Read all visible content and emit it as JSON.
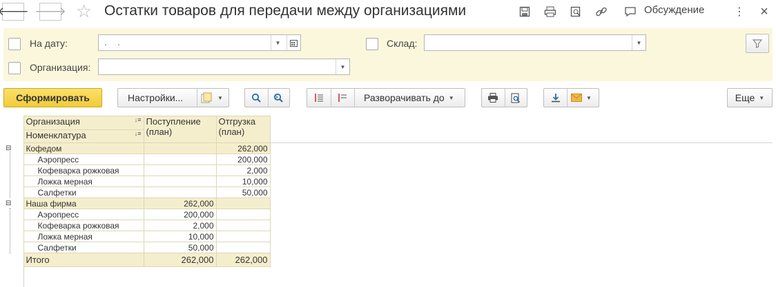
{
  "header": {
    "title": "Остатки товаров для передачи между организациями",
    "discuss_label": "Обсуждение",
    "close_label": "×"
  },
  "filters": {
    "date_label": "На дату:",
    "date_value": ". .",
    "warehouse_label": "Склад:",
    "warehouse_value": "",
    "org_label": "Организация:",
    "org_value": ""
  },
  "toolbar": {
    "generate_label": "Сформировать",
    "settings_label": "Настройки...",
    "expand_label": "Разворачивать до",
    "more_label": "Еще"
  },
  "report": {
    "columns": {
      "org": "Организация",
      "item": "Номенклатура",
      "receipt": "Поступление (план)",
      "receipt_l1": "Поступление",
      "receipt_l2": "(план)",
      "shipment_l1": "Отгрузка",
      "shipment_l2": "(план)"
    },
    "groups": [
      {
        "name": "Кофедом",
        "receipt": "",
        "shipment": "262,000",
        "rows": [
          {
            "name": "Аэропресс",
            "receipt": "",
            "shipment": "200,000"
          },
          {
            "name": "Кофеварка рожковая",
            "receipt": "",
            "shipment": "2,000"
          },
          {
            "name": "Ложка мерная",
            "receipt": "",
            "shipment": "10,000"
          },
          {
            "name": "Салфетки",
            "receipt": "",
            "shipment": "50,000"
          }
        ]
      },
      {
        "name": "Наша фирма",
        "receipt": "262,000",
        "shipment": "",
        "rows": [
          {
            "name": "Аэропресс",
            "receipt": "200,000",
            "shipment": ""
          },
          {
            "name": "Кофеварка рожковая",
            "receipt": "2,000",
            "shipment": ""
          },
          {
            "name": "Ложка мерная",
            "receipt": "10,000",
            "shipment": ""
          },
          {
            "name": "Салфетки",
            "receipt": "50,000",
            "shipment": ""
          }
        ]
      }
    ],
    "total": {
      "label": "Итого",
      "receipt": "262,000",
      "shipment": "262,000"
    }
  },
  "icons": {
    "back": "arrow-left-icon",
    "forward": "arrow-right-icon",
    "favorite": "star-icon",
    "save": "save-icon",
    "print": "print-icon",
    "preview": "preview-icon",
    "link": "link-icon",
    "discuss": "chat-icon",
    "more": "more-vertical-icon",
    "close": "close-icon"
  },
  "colors": {
    "primary_button": "#f1cc36",
    "filter_panel": "#fbf7dc",
    "table_header": "#f5eecc"
  }
}
